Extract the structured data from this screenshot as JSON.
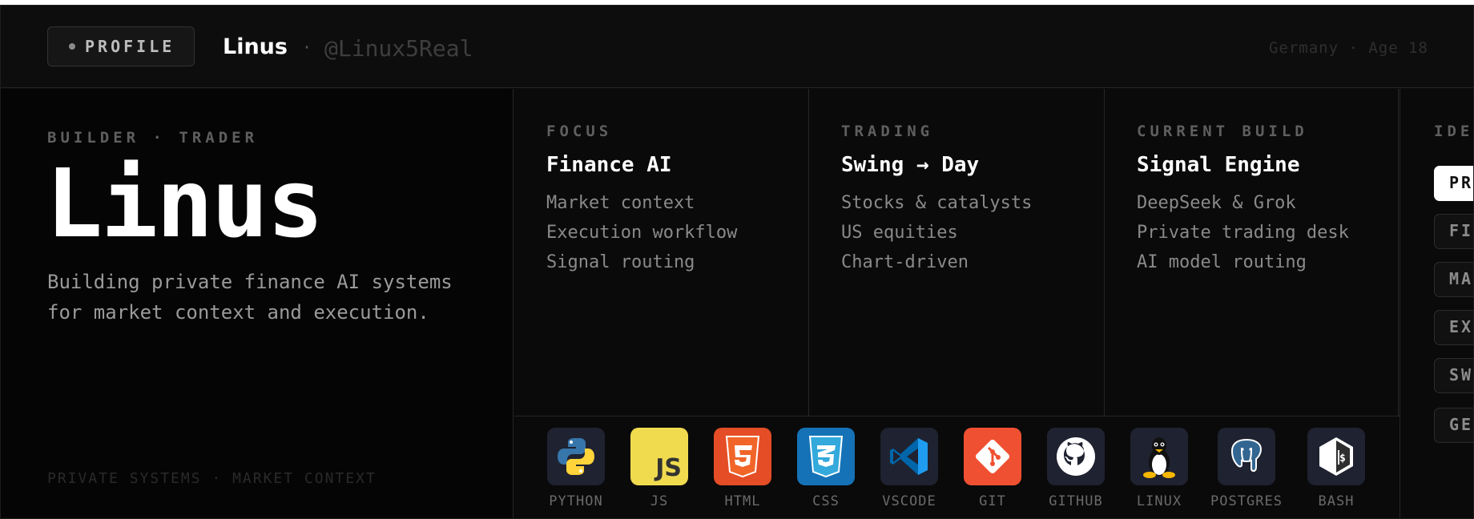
{
  "header": {
    "profile_label": "PROFILE",
    "name": "Linus",
    "separator": "·",
    "handle": "@Linux5Real",
    "location_age": "Germany · Age 18"
  },
  "hero": {
    "kicker": "BUILDER · TRADER",
    "title": "Linus",
    "description": "Building private finance AI systems for market context and execution.",
    "footer": "PRIVATE SYSTEMS · MARKET CONTEXT"
  },
  "columns": [
    {
      "kicker": "FOCUS",
      "title": "Finance AI",
      "items": [
        "Market context",
        "Execution workflow",
        "Signal routing"
      ]
    },
    {
      "kicker": "TRADING",
      "title": "Swing → Day",
      "items": [
        "Stocks & catalysts",
        "US equities",
        "Chart-driven"
      ]
    },
    {
      "kicker": "CURRENT BUILD",
      "title": "Signal Engine",
      "items": [
        "DeepSeek & Grok",
        "Private trading desk",
        "AI model routing"
      ]
    }
  ],
  "ideas": {
    "kicker": "IDEAS",
    "pills": [
      "PR",
      "FI",
      "MA",
      "EX",
      "SW",
      "GE"
    ]
  },
  "tech": [
    {
      "name": "PYTHON",
      "icon": "python-icon"
    },
    {
      "name": "JS",
      "icon": "js-icon"
    },
    {
      "name": "HTML",
      "icon": "html5-icon"
    },
    {
      "name": "CSS",
      "icon": "css3-icon"
    },
    {
      "name": "VSCODE",
      "icon": "vscode-icon"
    },
    {
      "name": "GIT",
      "icon": "git-icon"
    },
    {
      "name": "GITHUB",
      "icon": "github-icon"
    },
    {
      "name": "LINUX",
      "icon": "linux-icon"
    },
    {
      "name": "POSTGRES",
      "icon": "postgres-icon"
    },
    {
      "name": "BASH",
      "icon": "bash-icon"
    }
  ],
  "colors": {
    "background": "#0a0a0a",
    "text_primary": "#ffffff",
    "text_muted": "#8a8a8a",
    "border": "#262626",
    "js_yellow": "#f0db4f",
    "html_orange": "#e44d26",
    "css_blue": "#1572b6",
    "git_red": "#f05032"
  }
}
